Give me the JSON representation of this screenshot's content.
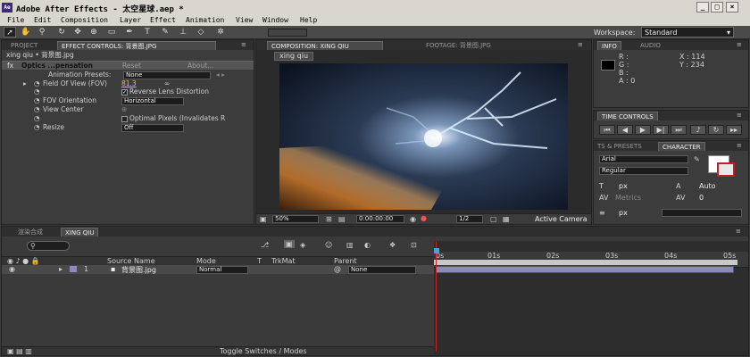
{
  "window": {
    "title": "Adobe After Effects - 太空星球.aep *",
    "app_icon": "Ae"
  },
  "menu": [
    "File",
    "Edit",
    "Composition",
    "Layer",
    "Effect",
    "Animation",
    "View",
    "Window",
    "Help"
  ],
  "workspace": {
    "label": "Workspace:",
    "value": "Standard"
  },
  "left_panel": {
    "tabs": [
      "PROJECT",
      "EFFECT CONTROLS: 背景图.jpg"
    ],
    "breadcrumb": "xing qiu • 背景图.jpg",
    "effect_name": "Optics ...pensation",
    "reset": "Reset",
    "about": "About...",
    "animation_presets_label": "Animation Presets:",
    "animation_presets_value": "None",
    "fov_label": "Field Of View (FOV)",
    "fov_value": "81.3",
    "reverse_label": "Reverse Lens Distortion",
    "fov_orientation_label": "FOV Orientation",
    "fov_orientation_value": "Horizontal",
    "view_center_label": "View Center",
    "optimal_pixels_label": "Optimal Pixels (Invalidates R",
    "resize_label": "Resize",
    "resize_value": "Off"
  },
  "comp_panel": {
    "tabs": [
      "COMPOSITION: xing qiu",
      "FOOTAGE: 背景图.jpg"
    ],
    "comp_name": "xing qiu",
    "zoom": "50%",
    "timecode": "0:00:00:00",
    "resolution": "1/2",
    "camera": "Active Camera"
  },
  "info_panel": {
    "tabs": [
      "INFO",
      "AUDIO"
    ],
    "r": "R :",
    "g": "G :",
    "b": "B :",
    "a": "A : 0",
    "x": "X : 114",
    "y": "Y : 234"
  },
  "time_controls": {
    "tab": "TIME CONTROLS"
  },
  "character_panel": {
    "tabs": [
      "TS & PRESETS",
      "CHARACTER"
    ],
    "font": "Arial",
    "style": "Regular",
    "size": "px",
    "leading": "Auto",
    "kerning": "Metrics",
    "tracking": "0",
    "stroke": "px"
  },
  "timeline": {
    "tabs": [
      "渲染合成",
      "xing qiu"
    ],
    "search_placeholder": "",
    "columns": [
      "Source Name",
      "Mode",
      "T",
      "TrkMat",
      "Parent"
    ],
    "layers": [
      {
        "num": "1",
        "name": "背景图.jpg",
        "mode": "Normal",
        "parent": "None"
      }
    ],
    "ruler": [
      "0s",
      "01s",
      "02s",
      "03s",
      "04s",
      "05s"
    ],
    "footer": "Toggle Switches / Modes"
  },
  "colors": {
    "accent": "#e0c05a",
    "playhead": "#d02020",
    "workarea": "#8a8ac0"
  }
}
